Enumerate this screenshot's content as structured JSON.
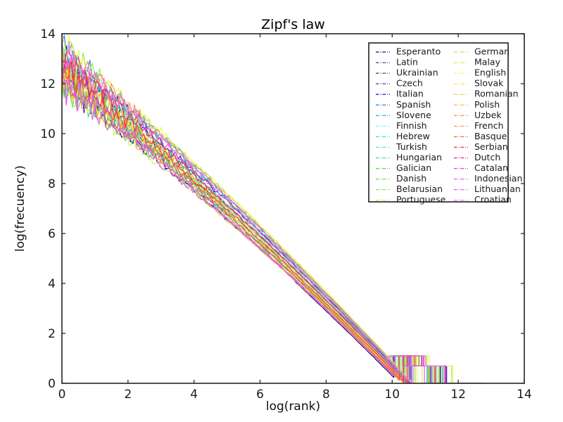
{
  "chart_data": {
    "type": "line",
    "title": "Zipf's law",
    "xlabel": "log(rank)",
    "ylabel": "log(frecuency)",
    "xlim": [
      0,
      14
    ],
    "ylim": [
      0,
      14
    ],
    "xticks": [
      0,
      2,
      4,
      6,
      8,
      10,
      12,
      14
    ],
    "yticks": [
      0,
      2,
      4,
      6,
      8,
      10,
      12,
      14
    ],
    "grid": false,
    "legend_position": "upper right",
    "legend_columns": 2,
    "marker": "dotted-markers",
    "description": "Log-log rank-frequency curves for 28 languages; curves start between log(frequency) 11.8 and 13.5 at log(rank)=0, converge into a tight bundle at mid-range, and descend in staircase steps to 0 near log(rank) 11.5-13.",
    "series": [
      {
        "name": "Esperanto",
        "color": "#0000a0",
        "y0": 12.05,
        "slope": 1.015,
        "knee": 10.05,
        "end": 12.35,
        "seed": 3
      },
      {
        "name": "Latin",
        "color": "#3c5f8c",
        "y0": 12.3,
        "slope": 1.03,
        "knee": 10.2,
        "end": 12.45,
        "seed": 11
      },
      {
        "name": "Ukrainian",
        "color": "#27563f",
        "y0": 12.55,
        "slope": 1.045,
        "knee": 10.35,
        "end": 12.6,
        "seed": 19
      },
      {
        "name": "Czech",
        "color": "#2a3fb5",
        "y0": 12.8,
        "slope": 1.055,
        "knee": 10.45,
        "end": 12.7,
        "seed": 27
      },
      {
        "name": "Italian",
        "color": "#2020d0",
        "y0": 13.05,
        "slope": 1.07,
        "knee": 10.55,
        "end": 12.8,
        "seed": 35
      },
      {
        "name": "Spanish",
        "color": "#1e7fe0",
        "y0": 13.3,
        "slope": 1.085,
        "knee": 10.6,
        "end": 12.85,
        "seed": 43
      },
      {
        "name": "Slovene",
        "color": "#19bff0",
        "y0": 12.15,
        "slope": 1.0,
        "knee": 10.0,
        "end": 12.3,
        "seed": 51
      },
      {
        "name": "Finnish",
        "color": "#7de8fb",
        "y0": 12.4,
        "slope": 1.02,
        "knee": 10.15,
        "end": 12.4,
        "seed": 59
      },
      {
        "name": "Hebrew",
        "color": "#2ae0d0",
        "y0": 12.65,
        "slope": 1.04,
        "knee": 10.3,
        "end": 12.55,
        "seed": 67
      },
      {
        "name": "Turkish",
        "color": "#5fe8a8",
        "y0": 12.9,
        "slope": 1.06,
        "knee": 10.4,
        "end": 12.65,
        "seed": 75
      },
      {
        "name": "Hungarian",
        "color": "#39d96b",
        "y0": 13.15,
        "slope": 1.075,
        "knee": 10.5,
        "end": 12.75,
        "seed": 83
      },
      {
        "name": "Galician",
        "color": "#4fd63f",
        "y0": 11.95,
        "slope": 0.995,
        "knee": 9.95,
        "end": 12.2,
        "seed": 91
      },
      {
        "name": "Danish",
        "color": "#63d636",
        "y0": 12.2,
        "slope": 1.01,
        "knee": 10.1,
        "end": 12.35,
        "seed": 99
      },
      {
        "name": "Belarusian",
        "color": "#8be05a",
        "y0": 12.45,
        "slope": 1.035,
        "knee": 10.25,
        "end": 12.5,
        "seed": 107
      },
      {
        "name": "Portuguese",
        "color": "#b6f06a",
        "y0": 12.7,
        "slope": 1.05,
        "knee": 10.38,
        "end": 12.62,
        "seed": 115
      },
      {
        "name": "German",
        "color": "#9ce84f",
        "y0": 13.45,
        "slope": 1.095,
        "knee": 10.7,
        "end": 12.92,
        "seed": 123
      },
      {
        "name": "Malay",
        "color": "#cdf25c",
        "y0": 11.85,
        "slope": 0.985,
        "knee": 9.85,
        "end": 12.1,
        "seed": 131
      },
      {
        "name": "English",
        "color": "#eef75a",
        "y0": 13.5,
        "slope": 1.1,
        "knee": 10.75,
        "end": 12.95,
        "seed": 139
      },
      {
        "name": "Slovak",
        "color": "#f7e34f",
        "y0": 12.25,
        "slope": 1.025,
        "knee": 10.18,
        "end": 12.42,
        "seed": 147
      },
      {
        "name": "Romanian",
        "color": "#f9cc45",
        "y0": 12.5,
        "slope": 1.042,
        "knee": 10.32,
        "end": 12.58,
        "seed": 155
      },
      {
        "name": "Polish",
        "color": "#f9b63c",
        "y0": 12.75,
        "slope": 1.058,
        "knee": 10.44,
        "end": 12.68,
        "seed": 163
      },
      {
        "name": "Uzbek",
        "color": "#f79a2e",
        "y0": 12.0,
        "slope": 1.005,
        "knee": 10.02,
        "end": 12.28,
        "seed": 171
      },
      {
        "name": "French",
        "color": "#f98a62",
        "y0": 13.35,
        "slope": 1.09,
        "knee": 10.65,
        "end": 12.88,
        "seed": 179
      },
      {
        "name": "Basque",
        "color": "#f4593c",
        "y0": 12.35,
        "slope": 1.032,
        "knee": 10.22,
        "end": 12.46,
        "seed": 187
      },
      {
        "name": "Serbian",
        "color": "#f23b3b",
        "y0": 12.6,
        "slope": 1.048,
        "knee": 10.34,
        "end": 12.56,
        "seed": 195
      },
      {
        "name": "Dutch",
        "color": "#e8246e",
        "y0": 12.85,
        "slope": 1.062,
        "knee": 10.46,
        "end": 12.72,
        "seed": 203
      },
      {
        "name": "Catalan",
        "color": "#ee3ad0",
        "y0": 13.1,
        "slope": 1.078,
        "knee": 10.52,
        "end": 12.78,
        "seed": 211
      },
      {
        "name": "Indonesian",
        "color": "#f050ee",
        "y0": 11.9,
        "slope": 0.99,
        "knee": 9.9,
        "end": 12.15,
        "seed": 219
      },
      {
        "name": "Lithuanian",
        "color": "#d45cf5",
        "y0": 12.1,
        "slope": 1.012,
        "knee": 10.08,
        "end": 12.32,
        "seed": 227
      },
      {
        "name": "Croatian",
        "color": "#ef7bf7",
        "y0": 13.25,
        "slope": 1.082,
        "knee": 10.58,
        "end": 12.82,
        "seed": 235
      }
    ]
  },
  "legend": {
    "columns": [
      {
        "entries": [
          {
            "label": "Esperanto",
            "color": "#0000a0"
          },
          {
            "label": "Latin",
            "color": "#3c5f8c"
          },
          {
            "label": "Ukrainian",
            "color": "#27563f"
          },
          {
            "label": "Czech",
            "color": "#2a3fb5"
          },
          {
            "label": "Italian",
            "color": "#2020d0"
          },
          {
            "label": "Spanish",
            "color": "#1e7fe0"
          },
          {
            "label": "Slovene",
            "color": "#19bff0"
          },
          {
            "label": "Finnish",
            "color": "#7de8fb"
          },
          {
            "label": "Hebrew",
            "color": "#2ae0d0"
          },
          {
            "label": "Turkish",
            "color": "#5fe8a8"
          },
          {
            "label": "Hungarian",
            "color": "#39d96b"
          },
          {
            "label": "Galician",
            "color": "#4fd63f"
          },
          {
            "label": "Danish",
            "color": "#63d636"
          },
          {
            "label": "Belarusian",
            "color": "#8be05a"
          },
          {
            "label": "Portuguese",
            "color": "#b6f06a"
          }
        ]
      },
      {
        "entries": [
          {
            "label": "German",
            "color": "#9ce84f"
          },
          {
            "label": "Malay",
            "color": "#cdf25c"
          },
          {
            "label": "English",
            "color": "#eef75a"
          },
          {
            "label": "Slovak",
            "color": "#f7e34f"
          },
          {
            "label": "Romanian",
            "color": "#f9cc45"
          },
          {
            "label": "Polish",
            "color": "#f9b63c"
          },
          {
            "label": "Uzbek",
            "color": "#f79a2e"
          },
          {
            "label": "French",
            "color": "#f98a62"
          },
          {
            "label": "Basque",
            "color": "#f4593c"
          },
          {
            "label": "Serbian",
            "color": "#f23b3b"
          },
          {
            "label": "Dutch",
            "color": "#e8246e"
          },
          {
            "label": "Catalan",
            "color": "#ee3ad0"
          },
          {
            "label": "Indonesian",
            "color": "#f050ee"
          },
          {
            "label": "Lithuanian",
            "color": "#d45cf5"
          },
          {
            "label": "Croatian",
            "color": "#ef7bf7"
          }
        ]
      }
    ]
  }
}
